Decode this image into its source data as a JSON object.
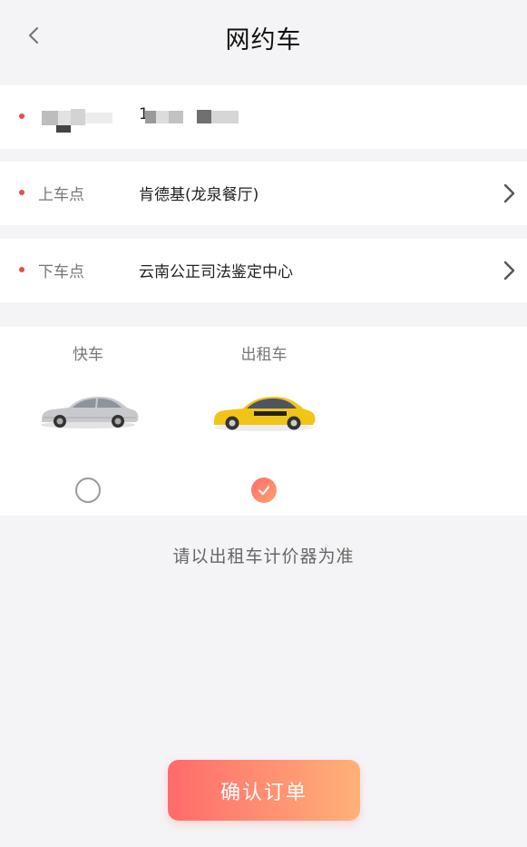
{
  "header": {
    "title": "网约车"
  },
  "passenger_row": {
    "phone_prefix": "1"
  },
  "pickup_row": {
    "label": "上车点",
    "value": "肯德基(龙泉餐厅)"
  },
  "dropoff_row": {
    "label": "下车点",
    "value": "云南公正司法鉴定中心"
  },
  "car_types": [
    {
      "name": "快车",
      "selected": false
    },
    {
      "name": "出租车",
      "selected": true
    }
  ],
  "note": "请以出租车计价器为准",
  "confirm_button": {
    "label": "确认订单"
  },
  "colors": {
    "accent_start": "#ff6b6b",
    "accent_end": "#ffb178",
    "dot": "#e94b4b",
    "background": "#f4f4f6"
  }
}
